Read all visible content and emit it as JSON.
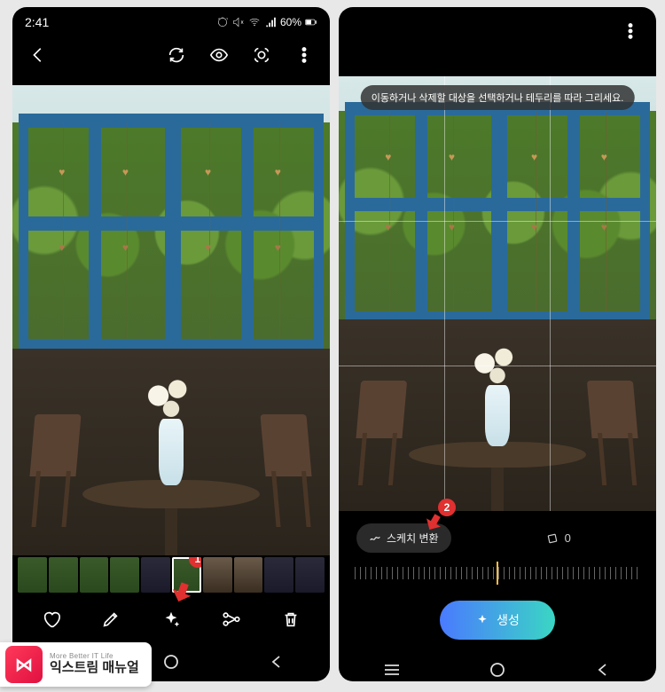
{
  "status": {
    "time": "2:41",
    "battery": "60%"
  },
  "left": {
    "badge": "1",
    "actions": [
      "favorite",
      "edit",
      "ai-sparkle",
      "share",
      "delete"
    ]
  },
  "right": {
    "hint": "이동하거나 삭제할 대상을 선택하거나 테두리를 따라 그리세요.",
    "badge": "2",
    "sketch_label": "스케치 변환",
    "rotation_value": "0",
    "generate_label": "생성"
  },
  "watermark": {
    "logo": "⋈",
    "sub": "More Better IT Life",
    "main": "익스트림 매뉴얼"
  }
}
